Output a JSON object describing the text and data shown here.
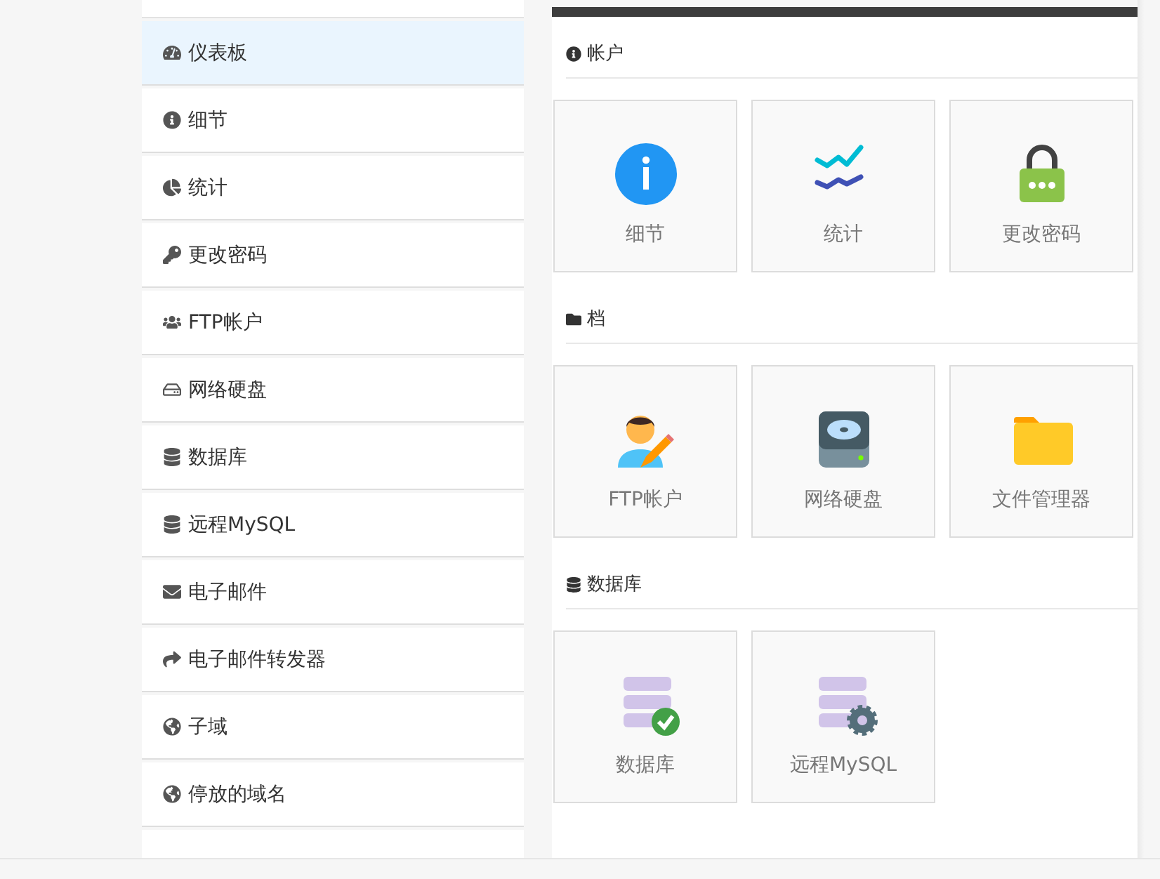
{
  "sidebar": {
    "items": [
      {
        "label": "仪表板",
        "kind": "dashboard",
        "selected": true
      },
      {
        "label": "细节",
        "kind": "info",
        "selected": false
      },
      {
        "label": "统计",
        "kind": "pie",
        "selected": false
      },
      {
        "label": "更改密码",
        "kind": "key",
        "selected": false
      },
      {
        "label": "FTP帐户",
        "kind": "users",
        "selected": false
      },
      {
        "label": "网络硬盘",
        "kind": "drive",
        "selected": false
      },
      {
        "label": "数据库",
        "kind": "database",
        "selected": false
      },
      {
        "label": "远程MySQL",
        "kind": "database",
        "selected": false
      },
      {
        "label": "电子邮件",
        "kind": "envelope",
        "selected": false
      },
      {
        "label": "电子邮件转发器",
        "kind": "forward",
        "selected": false
      },
      {
        "label": "子域",
        "kind": "globe",
        "selected": false
      },
      {
        "label": "停放的域名",
        "kind": "globe",
        "selected": false
      }
    ]
  },
  "sections": [
    {
      "title": "帐户",
      "kind": "info",
      "tiles": [
        {
          "label": "细节",
          "kind": "info"
        },
        {
          "label": "统计",
          "kind": "stats"
        },
        {
          "label": "更改密码",
          "kind": "lock"
        }
      ]
    },
    {
      "title": "档",
      "kind": "folder",
      "tiles": [
        {
          "label": "FTP帐户",
          "kind": "user"
        },
        {
          "label": "网络硬盘",
          "kind": "drive"
        },
        {
          "label": "文件管理器",
          "kind": "folder"
        }
      ]
    },
    {
      "title": "数据库",
      "kind": "database",
      "tiles": [
        {
          "label": "数据库",
          "kind": "db-check"
        },
        {
          "label": "远程MySQL",
          "kind": "db-gear"
        }
      ]
    }
  ]
}
